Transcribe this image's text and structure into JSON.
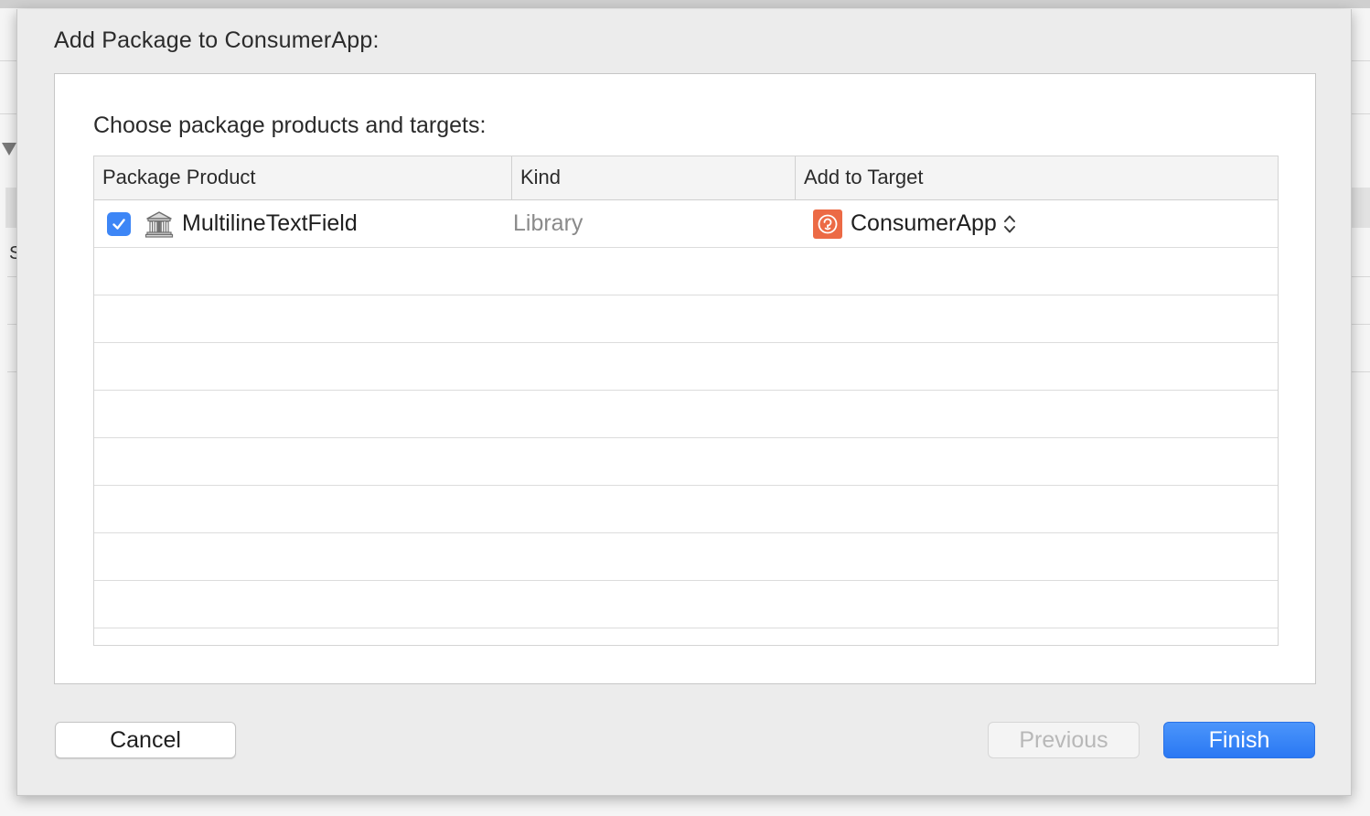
{
  "sheet": {
    "title": "Add Package to ConsumerApp:",
    "heading": "Choose package products and targets:"
  },
  "table": {
    "columns": [
      "Package Product",
      "Kind",
      "Add to Target"
    ],
    "rows": [
      {
        "checked": true,
        "product": "MultilineTextField",
        "product_icon": "package-library-icon",
        "kind": "Library",
        "target": "ConsumerApp",
        "target_icon": "app-target-icon"
      }
    ],
    "empty_row_count": 9
  },
  "buttons": {
    "cancel": "Cancel",
    "previous": "Previous",
    "finish": "Finish"
  },
  "background": {
    "partial_letter": "S"
  },
  "colors": {
    "accent": "#2a78f3",
    "checkbox": "#3d86f6",
    "app_icon": "#ec6a45"
  }
}
